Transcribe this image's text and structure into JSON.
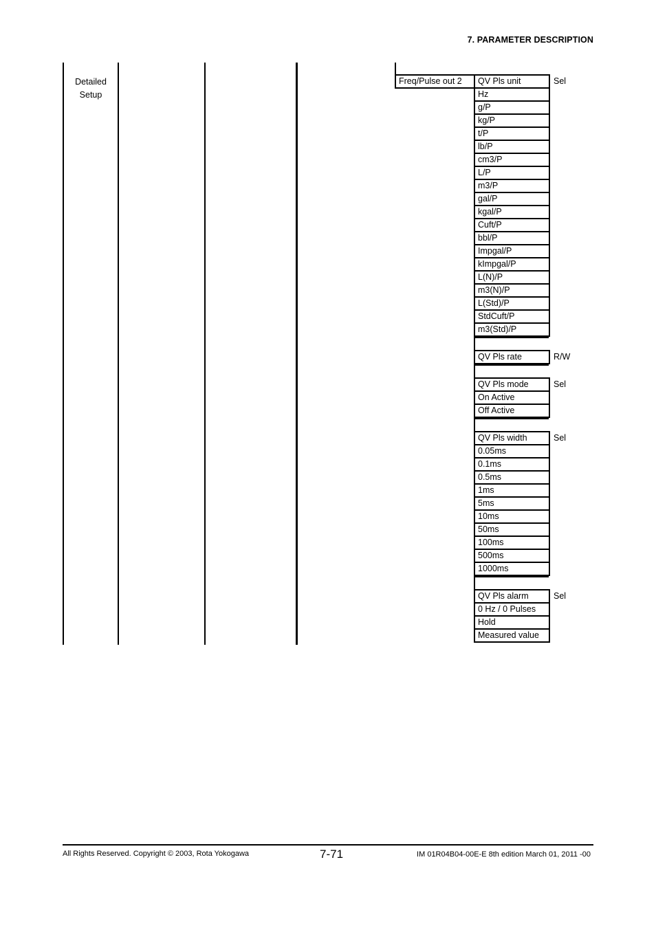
{
  "header": {
    "section_title": "7.  PARAMETER DESCRIPTION"
  },
  "menu_level1": {
    "label_line1": "Detailed",
    "label_line2": "Setup"
  },
  "menu_level5": {
    "label": "Freq/Pulse out 2"
  },
  "parameters": [
    {
      "name": "QV Pls unit",
      "access": "Sel",
      "options": [
        "Hz",
        "g/P",
        "kg/P",
        "t/P",
        "lb/P",
        "cm3/P",
        "L/P",
        "m3/P",
        "gal/P",
        "kgal/P",
        "Cuft/P",
        "bbl/P",
        "Impgal/P",
        "kImpgal/P",
        "L(N)/P",
        "m3(N)/P",
        "L(Std)/P",
        "StdCuft/P",
        "m3(Std)/P"
      ]
    },
    {
      "name": "QV Pls rate",
      "access": "R/W",
      "options": []
    },
    {
      "name": "QV Pls mode",
      "access": "Sel",
      "options": [
        "On Active",
        "Off Active"
      ]
    },
    {
      "name": "QV Pls width",
      "access": "Sel",
      "options": [
        "0.05ms",
        "0.1ms",
        "0.5ms",
        "1ms",
        "5ms",
        "10ms",
        "50ms",
        "100ms",
        "500ms",
        "1000ms"
      ]
    },
    {
      "name": "QV Pls alarm",
      "access": "Sel",
      "options": [
        "0 Hz / 0 Pulses",
        "Hold",
        "Measured value"
      ]
    }
  ],
  "footer": {
    "copyright": "All Rights Reserved. Copyright © 2003, Rota Yokogawa",
    "page_number": "7-71",
    "doc_id": "IM 01R04B04-00E-E  8th edition March 01, 2011 -00"
  }
}
